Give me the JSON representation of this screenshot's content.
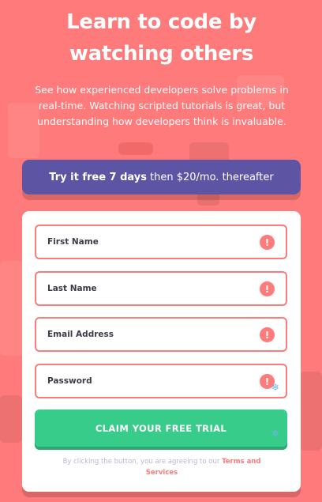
{
  "hero": {
    "title": "Learn to code by watching others",
    "description": "See how experienced developers solve problems in real-time. Watching scripted tutorials is great, but understanding how developers think is invaluable."
  },
  "banner": {
    "highlight": "Try it free 7 days",
    "rest": "then $20/mo. thereafter"
  },
  "form": {
    "fields": [
      {
        "placeholder": "First Name",
        "value": ""
      },
      {
        "placeholder": "Last Name",
        "value": ""
      },
      {
        "placeholder": "Email Address",
        "value": ""
      },
      {
        "placeholder": "Password",
        "value": ""
      }
    ],
    "error_glyph": "!",
    "submit_label": "CLAIM YOUR FREE TRIAL",
    "terms_prefix": "By clicking the button, you are agreeing to our",
    "terms_link": "Terms and Services"
  },
  "colors": {
    "background": "#ff7a7a",
    "banner": "#5e54a4",
    "cta": "#38cc8b",
    "error": "#ff7a7a"
  },
  "icons": [
    "error-icon",
    "gear-icon"
  ]
}
